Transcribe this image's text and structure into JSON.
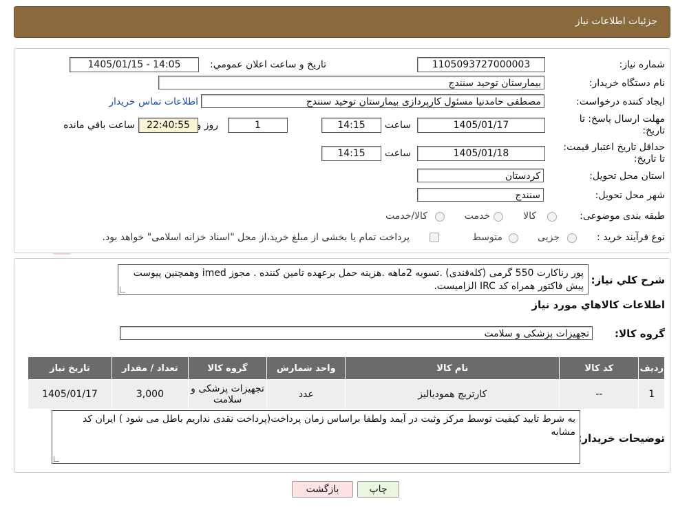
{
  "header": {
    "title": "جزئیات اطلاعات نیاز"
  },
  "form": {
    "need_number_label": "شماره نیاز:",
    "need_number": "1105093727000003",
    "announce_label": "تاریخ و ساعت اعلان عمومي:",
    "announce_value": "1405/01/15 - 14:05",
    "buyer_org_label": "نام دستگاه خریدار:",
    "buyer_org": "بیمارستان توحید سنندج",
    "creator_label": "ایجاد کننده درخواست:",
    "creator": "مصطفی حامدنیا مسئول کارپردازی بیمارستان توحید سنندج",
    "contact_link": "اطلاعات تماس خریدار",
    "deadline_label": "مهلت ارسال پاسخ: تا تاریخ:",
    "deadline_date": "1405/01/17",
    "time_label": "ساعت",
    "deadline_time": "14:15",
    "days_value": "1",
    "days_label": "روز و",
    "remaining_time": "22:40:55",
    "remaining_label": "ساعت باقي مانده",
    "validity_label": "حداقل تاریخ اعتبار قیمت: تا تاریخ:",
    "validity_date": "1405/01/18",
    "validity_time": "14:15",
    "province_label": "استان محل تحویل:",
    "province": "کردستان",
    "city_label": "شهر محل تحویل:",
    "city": "سنندج",
    "category_label": "طبقه بندی موضوعی:",
    "category_options": [
      "کالا",
      "خدمت",
      "کالا/خدمت"
    ],
    "process_label": "نوع فرآیند خرید :",
    "process_options": [
      "جزیی",
      "متوسط"
    ],
    "payment_note": "پرداخت تمام یا بخشی از مبلغ خرید،از محل \"اسناد خزانه اسلامی\" خواهد بود."
  },
  "description": {
    "label": "شرح کلي نیاز:",
    "text": "پور رناکارت 550 گرمی (کله‌قندی) .تسویه 2ماهه .هزینه حمل برعهده تامین کننده . مجوز imed وهمچنین پیوست پیش فاکتور همراه کد IRC  الزامیست."
  },
  "goods": {
    "section_title": "اطلاعات کالاهاي مورد نیاز",
    "group_label": "گروه کالا:",
    "group_value": "تجهیزات پزشکی و سلامت",
    "columns": [
      "ردیف",
      "کد کالا",
      "نام کالا",
      "واحد شمارش",
      "گروه کالا",
      "تعداد / مقدار",
      "تاریخ نیاز"
    ],
    "rows": [
      {
        "row": "1",
        "code": "--",
        "name": "کارتریج همودیالیز",
        "unit": "عدد",
        "group": "تجهیزات پزشکی و سلامت",
        "qty": "3,000",
        "date": "1405/01/17"
      }
    ]
  },
  "buyer_notes": {
    "label": "توضیحات خریدار:",
    "text": "به شرط تایید کیفیت توسط مرکز وثبت در آیمد ولطفا براساس زمان پرداخت(پرداخت نقدی نداریم باطل می شود ) ایران کد مشابه"
  },
  "buttons": {
    "print": "چاپ",
    "back": "بازگشت"
  },
  "colors": {
    "header": "#8a6a3c",
    "table_header": "#6b6b6b",
    "link": "#1a4fb5"
  }
}
